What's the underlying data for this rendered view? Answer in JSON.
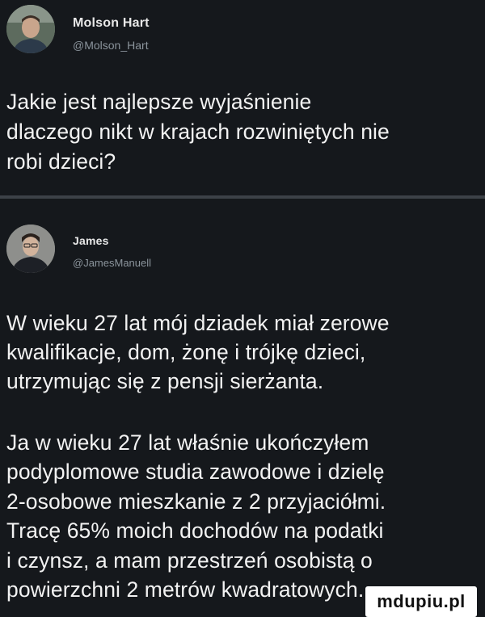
{
  "tweets": [
    {
      "author_name": "Molson Hart",
      "author_handle": "@Molson_Hart",
      "text": "Jakie jest najlepsze wyjaśnienie\ndlaczego nikt w krajach rozwiniętych nie\nrobi dzieci?"
    },
    {
      "author_name": "James",
      "author_handle": "@JamesManuell",
      "paragraph_1": "W wieku 27 lat mój dziadek miał zerowe\nkwalifikacje, dom, żonę i trójkę dzieci,\nutrzymując się z pensji sierżanta.",
      "paragraph_2": "Ja w wieku 27 lat właśnie ukończyłem\npodyplomowe studia zawodowe i dzielę\n2-osobowe mieszkanie z 2 przyjaciółmi.\nTracę 65% moich dochodów na podatki\ni czynsz, a mam przestrzeń osobistą o\npowierzchni 2 metrów kwadratowych."
    }
  ],
  "watermark": "mdupiu.pl",
  "colors": {
    "background": "#15181c",
    "text": "#f2f2f2",
    "handle": "#8b949c",
    "divider": "#3c4147"
  }
}
